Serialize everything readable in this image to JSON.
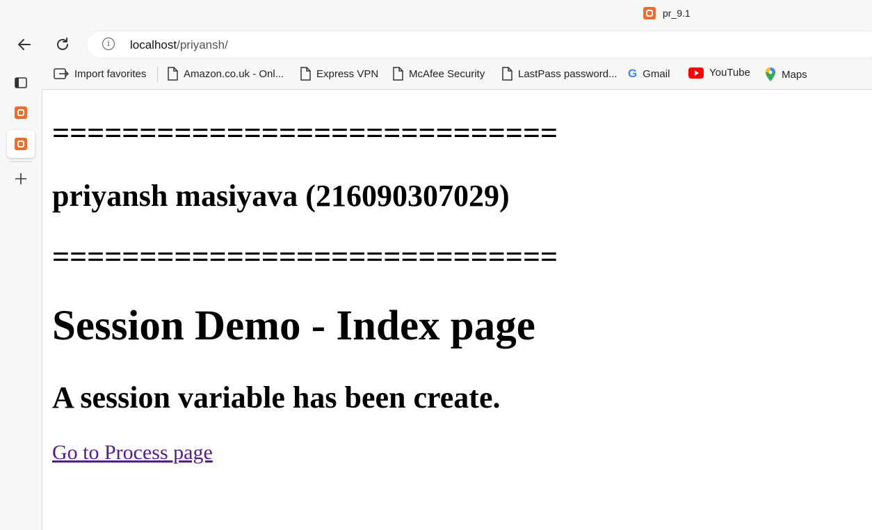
{
  "tab": {
    "title": "pr_9.1"
  },
  "navigation": {
    "back_icon": "arrow-left-icon",
    "refresh_icon": "refresh-icon",
    "address": {
      "host": "localhost",
      "path": "/priyansh/"
    }
  },
  "bookmarks": [
    {
      "label": "Import favorites",
      "icon": "import-icon"
    },
    {
      "label": "Amazon.co.uk - Onl...",
      "icon": "page-icon"
    },
    {
      "label": "Express VPN",
      "icon": "page-icon"
    },
    {
      "label": "McAfee Security",
      "icon": "page-icon"
    },
    {
      "label": "LastPass password...",
      "icon": "page-icon"
    },
    {
      "label": "Gmail",
      "icon": "google-icon"
    },
    {
      "label": "YouTube",
      "icon": "youtube-icon"
    },
    {
      "label": "Maps",
      "icon": "maps-icon"
    }
  ],
  "sidebar": [
    "tab-actions-icon",
    "xampp-icon",
    "xampp-icon",
    "add-icon"
  ],
  "page": {
    "divider_top": "=============================",
    "author": "priyansh masiyava (216090307029)",
    "divider_bottom": "=============================",
    "heading": "Session Demo - Index page",
    "message": "A session variable has been create.",
    "link": "Go to Process page"
  },
  "colors": {
    "link": "#551a8b",
    "xampp": "#ef6c2b",
    "youtube": "#ff0000"
  }
}
